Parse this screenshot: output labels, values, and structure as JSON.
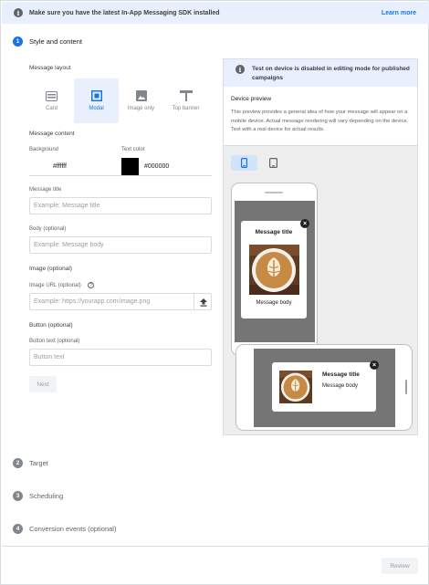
{
  "banner": {
    "text": "Make sure you have the latest In-App Messaging SDK installed",
    "link": "Learn more"
  },
  "steps": [
    {
      "num": "1",
      "label": "Style and content",
      "active": true
    },
    {
      "num": "2",
      "label": "Target"
    },
    {
      "num": "3",
      "label": "Scheduling"
    },
    {
      "num": "4",
      "label": "Conversion events (optional)"
    }
  ],
  "layout": {
    "label": "Message layout",
    "options": [
      {
        "label": "Card",
        "icon": "card-icon"
      },
      {
        "label": "Modal",
        "icon": "modal-icon",
        "selected": true
      },
      {
        "label": "Image only",
        "icon": "image-icon"
      },
      {
        "label": "Top banner",
        "icon": "top-banner-icon"
      }
    ]
  },
  "content": {
    "label": "Message content",
    "background_label": "Background",
    "background_value": "#ffffff",
    "text_color_label": "Text color",
    "text_color_value": "#000000",
    "title_label": "Message title",
    "title_placeholder": "Example: Message title",
    "body_label": "Body (optional)",
    "body_placeholder": "Example: Message body"
  },
  "image": {
    "label": "Image (optional)",
    "url_label": "Image URL (optional)",
    "url_placeholder": "Example: https://yourapp.com/image.png"
  },
  "button": {
    "label": "Button (optional)",
    "text_label": "Button text (optional)",
    "text_placeholder": "Button text"
  },
  "next_label": "Next",
  "review_label": "Review",
  "preview": {
    "notice": "Test on device is disabled in editing mode for published campaigns",
    "title": "Device preview",
    "description": "This preview provides a general idea of how your message will appear on a mobile device. Actual message rendering will vary depending on the device. Test with a real device for actual results.",
    "message_title": "Message title",
    "message_body": "Message body"
  },
  "colors": {
    "accent": "#1a73e8",
    "screen": "#757575",
    "swatch_bg": "#ffffff",
    "swatch_text": "#000000"
  }
}
